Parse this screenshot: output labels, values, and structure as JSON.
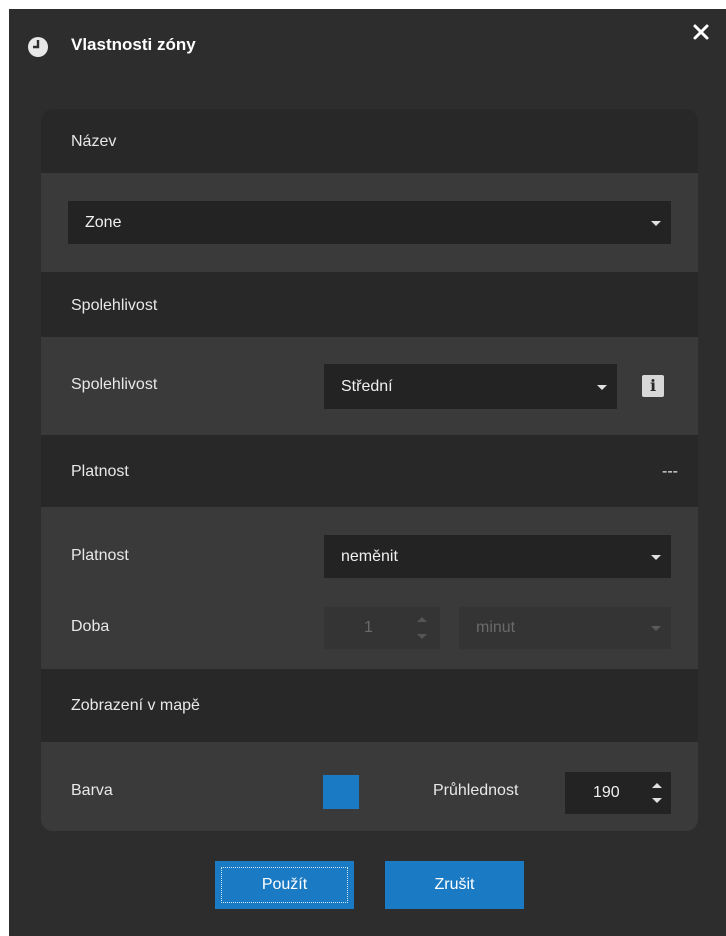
{
  "window": {
    "title": "Vlastnosti zóny",
    "close_glyph": "✕"
  },
  "sections": {
    "name": {
      "header": "Název",
      "select_value": "Zone"
    },
    "reliability": {
      "header": "Spolehlivost",
      "label": "Spolehlivost",
      "select_value": "Střední",
      "info_glyph": "i"
    },
    "validity": {
      "header": "Platnost",
      "header_value": "---",
      "label": "Platnost",
      "select_value": "neměnit",
      "duration_label": "Doba",
      "duration_value": "1",
      "unit_value": "minut"
    },
    "map_display": {
      "header": "Zobrazení v mapě",
      "color_label": "Barva",
      "color_value": "#1a7ac4",
      "opacity_label": "Průhlednost",
      "opacity_value": "190"
    }
  },
  "buttons": {
    "apply": "Použít",
    "cancel": "Zrušit"
  },
  "colors": {
    "accent": "#1a7ac4",
    "background": "#2d2d2d",
    "header": "#282828",
    "body": "#3a3a3a",
    "field": "#232323"
  },
  "icons": {
    "title": "clock-icon",
    "close": "close-icon",
    "info": "info-icon"
  }
}
